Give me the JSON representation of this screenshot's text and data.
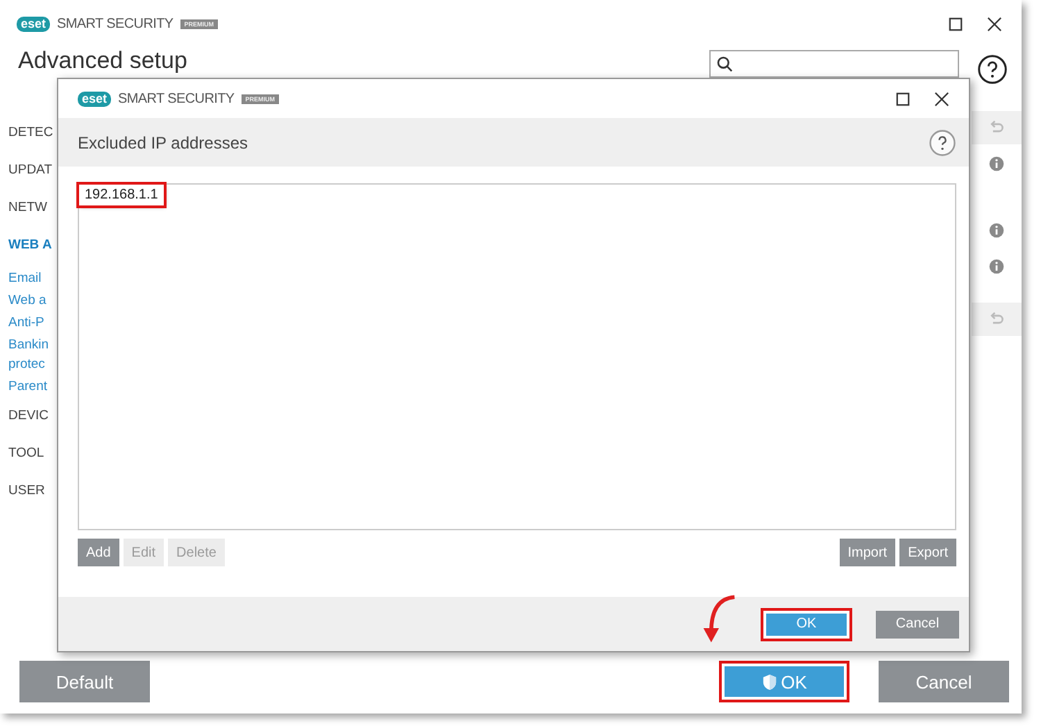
{
  "main_window": {
    "brand": {
      "logo": "eset",
      "product": "SMART SECURITY",
      "edition": "PREMIUM"
    },
    "title": "Advanced setup",
    "sidebar": [
      {
        "label": "DETEC",
        "kind": "section",
        "selected": false
      },
      {
        "label": "UPDAT",
        "kind": "section",
        "selected": false
      },
      {
        "label": "NETW",
        "kind": "section",
        "selected": false
      },
      {
        "label": "WEB A",
        "kind": "section",
        "selected": true
      },
      {
        "label": "Email",
        "kind": "link",
        "selected": false
      },
      {
        "label": "Web a",
        "kind": "link",
        "selected": false
      },
      {
        "label": "Anti-P",
        "kind": "link",
        "selected": false
      },
      {
        "label": "Bankin\nprotec",
        "kind": "link",
        "selected": false
      },
      {
        "label": "Parent",
        "kind": "link",
        "selected": false
      },
      {
        "label": "DEVIC",
        "kind": "section",
        "selected": false
      },
      {
        "label": "TOOL",
        "kind": "section",
        "selected": false
      },
      {
        "label": "USER",
        "kind": "section",
        "selected": false
      }
    ],
    "side_icons": [
      {
        "kind": "undo"
      },
      {
        "kind": "info"
      },
      {
        "kind": "info"
      },
      {
        "kind": "info"
      },
      {
        "kind": "undo"
      }
    ],
    "buttons": [
      {
        "label": "Default",
        "kind": "default",
        "highlighted": false
      },
      {
        "label": "OK",
        "kind": "primary",
        "highlighted": true
      },
      {
        "label": "Cancel",
        "kind": "default",
        "highlighted": false
      }
    ]
  },
  "dialog": {
    "brand": {
      "logo": "eset",
      "product": "SMART SECURITY",
      "edition": "PREMIUM"
    },
    "title": "Excluded IP addresses",
    "items": [
      {
        "text": "192.168.1.1",
        "highlighted": true
      }
    ],
    "list_buttons": [
      {
        "label": "Add",
        "disabled": false
      },
      {
        "label": "Edit",
        "disabled": true
      },
      {
        "label": "Delete",
        "disabled": true
      }
    ],
    "io_buttons": [
      {
        "label": "Import",
        "disabled": false
      },
      {
        "label": "Export",
        "disabled": false
      }
    ],
    "buttons": [
      {
        "label": "OK",
        "kind": "primary",
        "highlighted": true
      },
      {
        "label": "Cancel",
        "kind": "default",
        "highlighted": false
      }
    ]
  }
}
